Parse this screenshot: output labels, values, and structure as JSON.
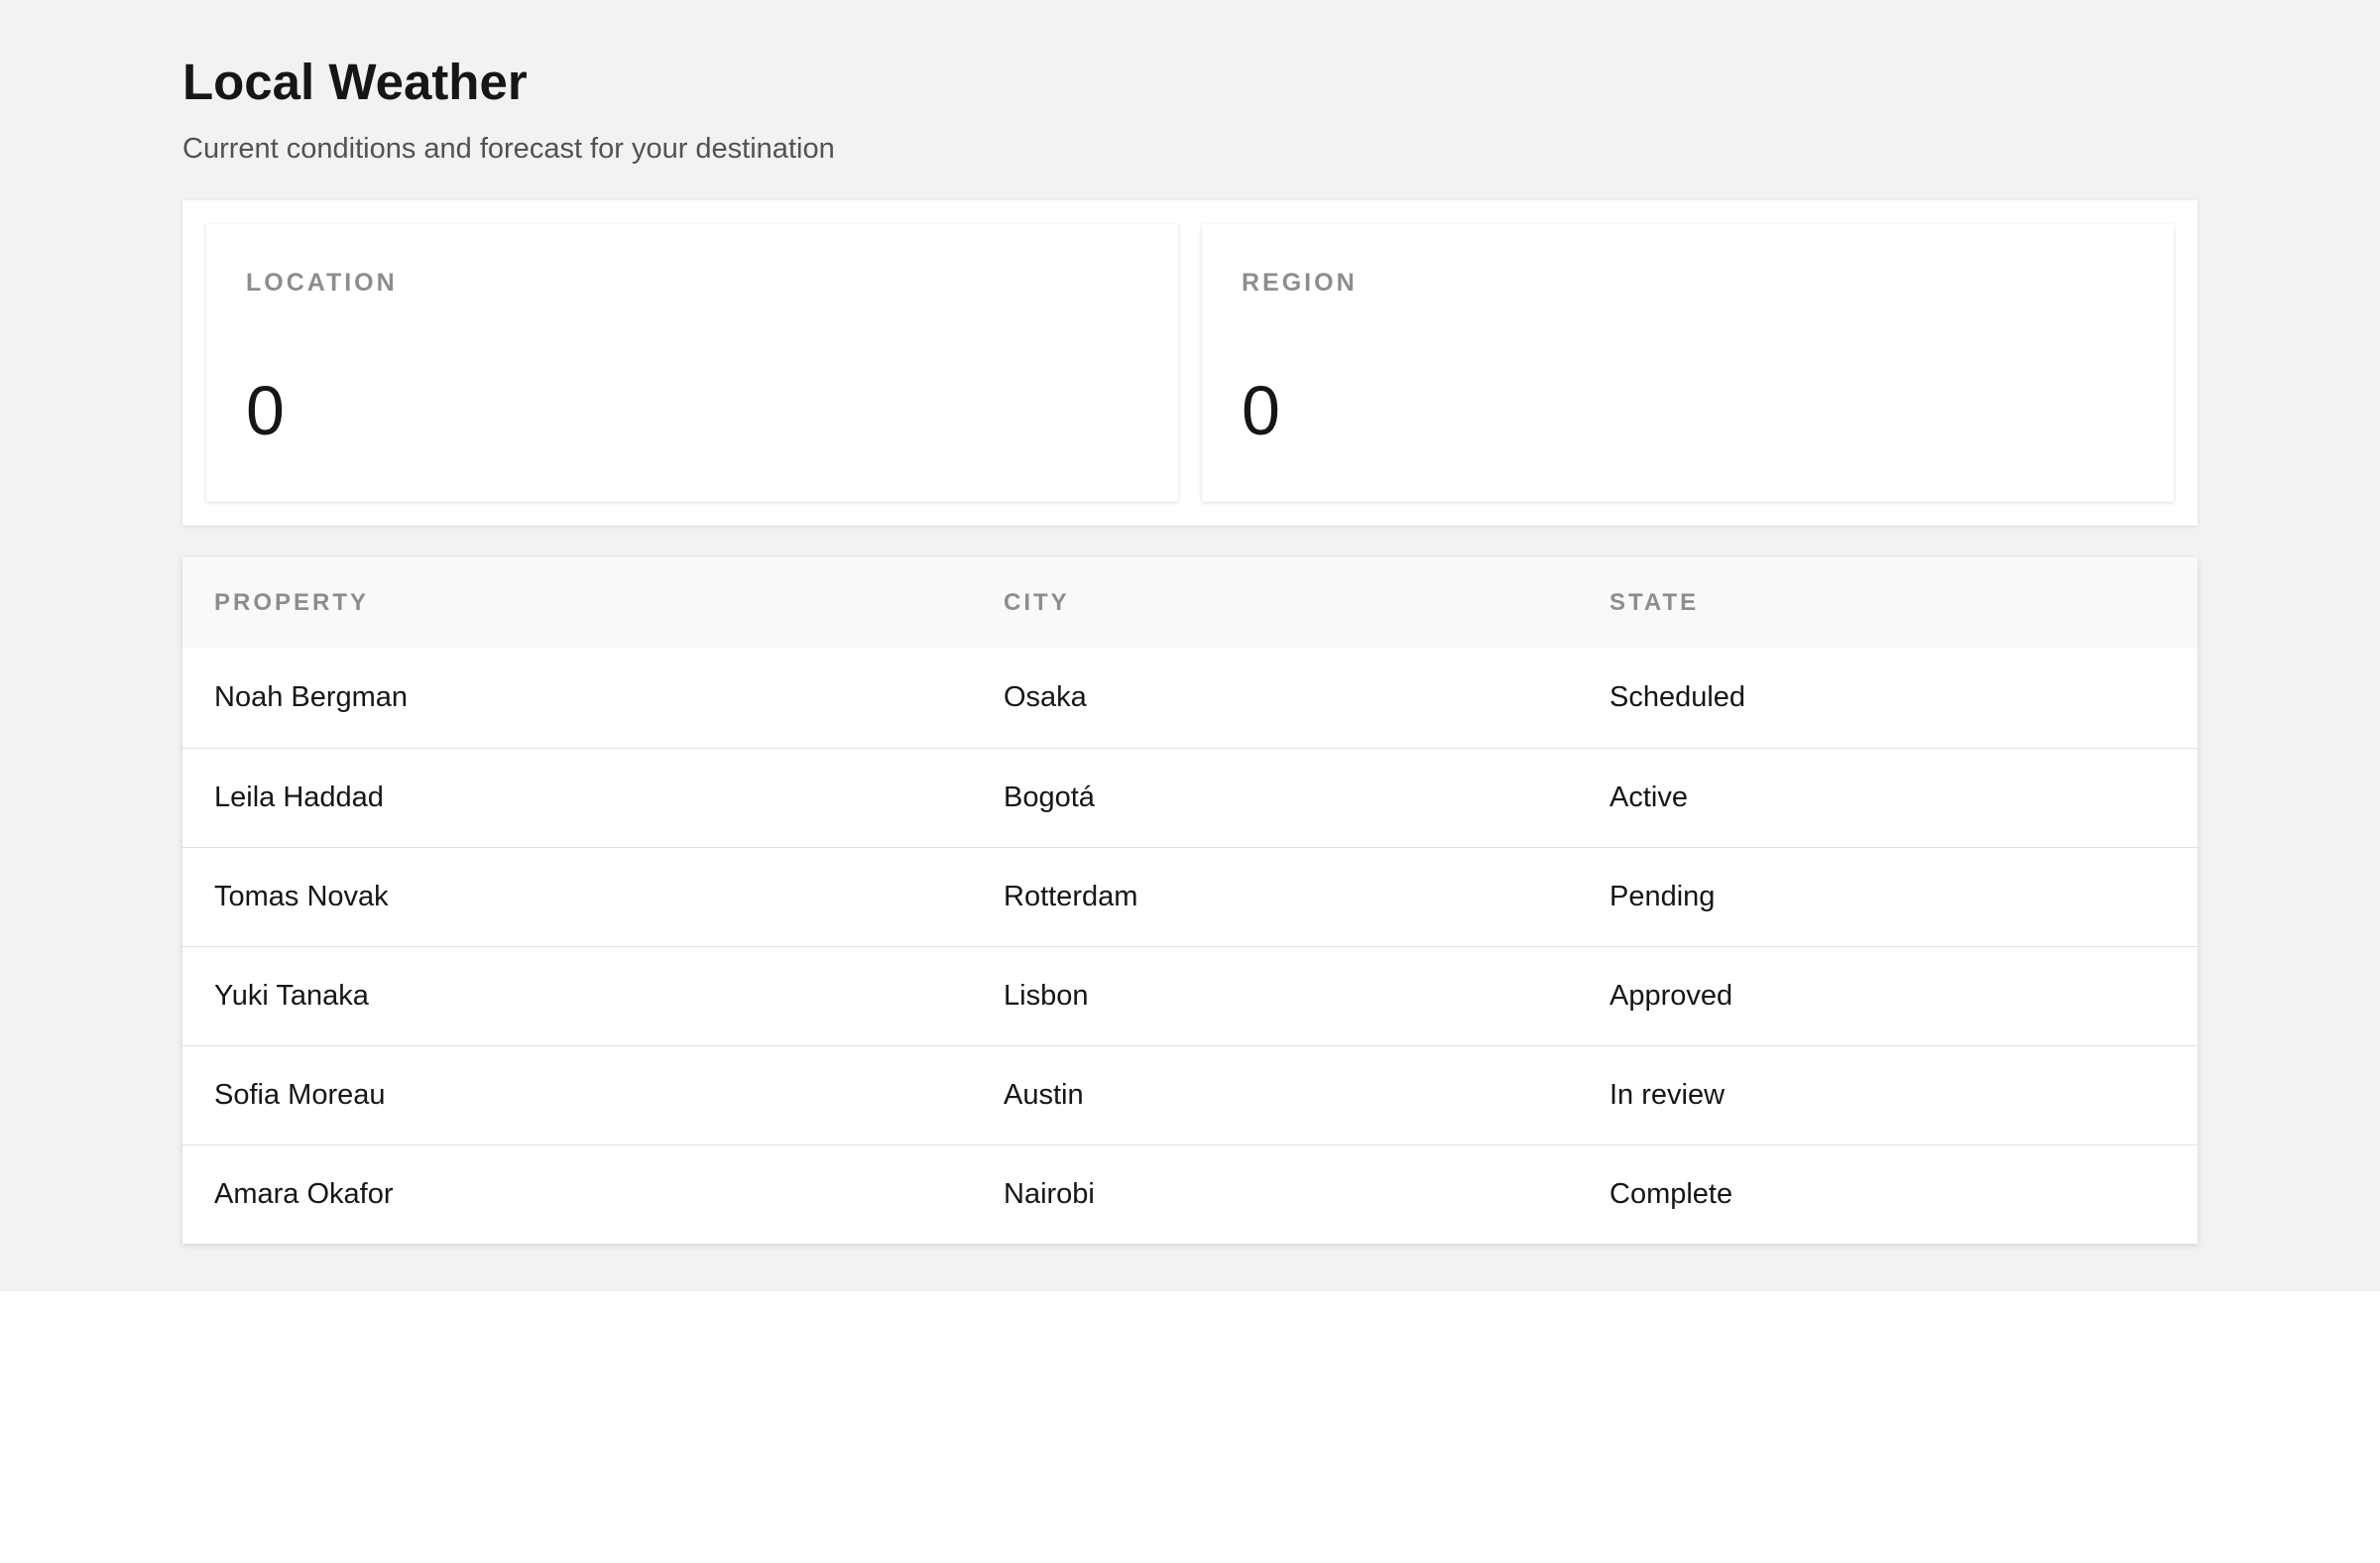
{
  "header": {
    "title": "Local Weather",
    "subtitle": "Current conditions and forecast for your destination"
  },
  "stats": [
    {
      "label": "LOCATION",
      "value": "0"
    },
    {
      "label": "REGION",
      "value": "0"
    }
  ],
  "table": {
    "columns": [
      "PROPERTY",
      "CITY",
      "STATE"
    ],
    "rows": [
      {
        "property": "Noah Bergman",
        "city": "Osaka",
        "state": "Scheduled"
      },
      {
        "property": "Leila Haddad",
        "city": "Bogotá",
        "state": "Active"
      },
      {
        "property": "Tomas Novak",
        "city": "Rotterdam",
        "state": "Pending"
      },
      {
        "property": "Yuki Tanaka",
        "city": "Lisbon",
        "state": "Approved"
      },
      {
        "property": "Sofia Moreau",
        "city": "Austin",
        "state": "In review"
      },
      {
        "property": "Amara Okafor",
        "city": "Nairobi",
        "state": "Complete"
      }
    ]
  }
}
